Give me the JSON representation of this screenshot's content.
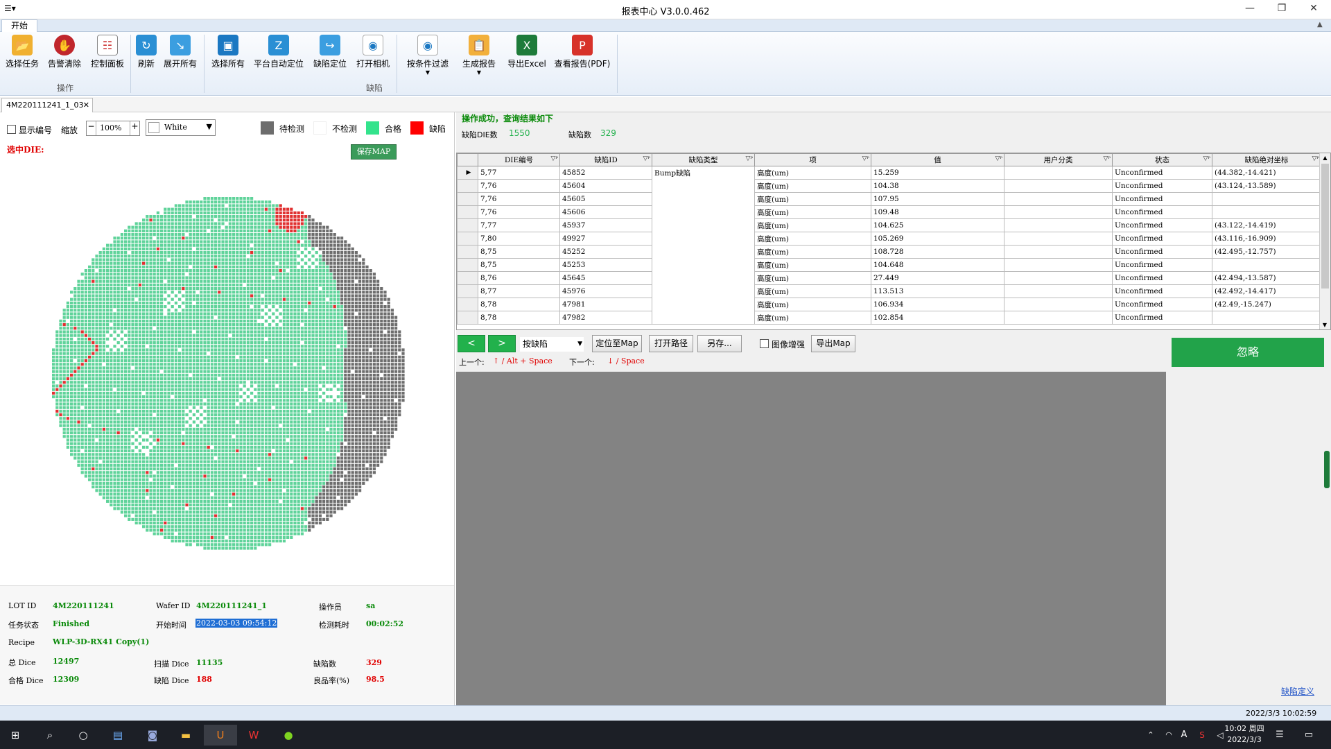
{
  "window": {
    "title": "报表中心 V3.0.0.462"
  },
  "ribbon": {
    "tab": "开始",
    "groups": [
      "操作",
      "缺陷"
    ],
    "buttons": {
      "select_task": "选择任务",
      "alarm_clear": "告警清除",
      "control_panel": "控制面板",
      "refresh": "刷新",
      "expand_all": "展开所有",
      "select_all": "选择所有",
      "auto_locate": "平台自动定位",
      "defect_locate": "缺陷定位",
      "open_camera": "打开相机",
      "filter": "按条件过滤",
      "gen_report": "生成报告",
      "export_excel": "导出Excel",
      "view_pdf": "查看报告(PDF)"
    }
  },
  "doc_tab": "4M220111241_1_03",
  "toolbar": {
    "show_number": "显示编号",
    "zoom_label": "缩放",
    "zoom_value": "100%",
    "color_value": "White",
    "selected_die": "选中DIE:",
    "save_map": "保存MAP"
  },
  "legend": [
    {
      "label": "待检测",
      "color": "#6d6d6d"
    },
    {
      "label": "不检测",
      "color": "#ffffff"
    },
    {
      "label": "合格",
      "color": "#33e38c"
    },
    {
      "label": "缺陷",
      "color": "#ff0000"
    }
  ],
  "info": {
    "lot_id_label": "LOT ID",
    "lot_id": "4M220111241",
    "wafer_id_label": "Wafer ID",
    "wafer_id": "4M220111241_1",
    "operator_label": "操作员",
    "operator": "sa",
    "task_status_label": "任务状态",
    "task_status": "Finished",
    "start_time_label": "开始时间",
    "start_time": "2022-03-03 09:54:12",
    "elapsed_label": "检测耗时",
    "elapsed": "00:02:52",
    "recipe_label": "Recipe",
    "recipe": "WLP-3D-RX41 Copy(1)",
    "total_dice_label": "总 Dice",
    "total_dice": "12497",
    "scan_dice_label": "扫描 Dice",
    "scan_dice": "11135",
    "defect_count_label": "缺陷数",
    "defect_count": "329",
    "pass_dice_label": "合格 Dice",
    "pass_dice": "12309",
    "defect_dice_label": "缺陷 Dice",
    "defect_dice": "188",
    "yield_label": "良品率(%)",
    "yield": "98.5"
  },
  "query": {
    "success": "操作成功，查询结果如下",
    "defect_die_label": "缺陷DIE数",
    "defect_die": "1550",
    "defect_count_label": "缺陷数",
    "defect_count": "329"
  },
  "table": {
    "headers": [
      "DIE编号",
      "缺陷ID",
      "缺陷类型",
      "项",
      "值",
      "用户分类",
      "状态",
      "缺陷绝对坐标"
    ],
    "rows": [
      [
        "5,77",
        "45852",
        "Bump缺陷",
        "高度(um)",
        "15.259",
        "",
        "Unconfirmed",
        "(44.382,-14.421)"
      ],
      [
        "7,76",
        "45604",
        "",
        "高度(um)",
        "104.38",
        "",
        "Unconfirmed",
        "(43.124,-13.589)"
      ],
      [
        "7,76",
        "45605",
        "",
        "高度(um)",
        "107.95",
        "",
        "Unconfirmed",
        ""
      ],
      [
        "7,76",
        "45606",
        "",
        "高度(um)",
        "109.48",
        "",
        "Unconfirmed",
        ""
      ],
      [
        "7,77",
        "45937",
        "",
        "高度(um)",
        "104.625",
        "",
        "Unconfirmed",
        "(43.122,-14.419)"
      ],
      [
        "7,80",
        "49927",
        "",
        "高度(um)",
        "105.269",
        "",
        "Unconfirmed",
        "(43.116,-16.909)"
      ],
      [
        "8,75",
        "45252",
        "",
        "高度(um)",
        "108.728",
        "",
        "Unconfirmed",
        "(42.495,-12.757)"
      ],
      [
        "8,75",
        "45253",
        "",
        "高度(um)",
        "104.648",
        "",
        "Unconfirmed",
        ""
      ],
      [
        "8,76",
        "45645",
        "",
        "高度(um)",
        "27.449",
        "",
        "Unconfirmed",
        "(42.494,-13.587)"
      ],
      [
        "8,77",
        "45976",
        "",
        "高度(um)",
        "113.513",
        "",
        "Unconfirmed",
        "(42.492,-14.417)"
      ],
      [
        "8,78",
        "47981",
        "",
        "高度(um)",
        "106.934",
        "",
        "Unconfirmed",
        "(42.49,-15.247)"
      ],
      [
        "8,78",
        "47982",
        "",
        "高度(um)",
        "102.854",
        "",
        "Unconfirmed",
        ""
      ]
    ]
  },
  "nav": {
    "prev": "<",
    "next": ">",
    "mode": "按缺陷",
    "locate_map": "定位至Map",
    "open_path": "打开路径",
    "save_as": "另存...",
    "enhance": "图像增强",
    "export_map": "导出Map",
    "ignore": "忽略",
    "prev_hint_label": "上一个:",
    "prev_hint": "↑ / Alt + Space",
    "next_hint_label": "下一个:",
    "next_hint": "↓ / Space",
    "defect_def": "缺陷定义"
  },
  "status": {
    "datetime": "2022/3/3 10:02:59"
  },
  "taskbar": {
    "time": "10:02 周四",
    "date": "2022/3/3",
    "ime": "A"
  },
  "colors": {
    "accent_green": "#22b14c",
    "value_green": "#0a8a0a",
    "value_red": "#e00000",
    "pass": "#5fd39a",
    "pending": "#6d6d6d",
    "defect": "#e03030"
  }
}
